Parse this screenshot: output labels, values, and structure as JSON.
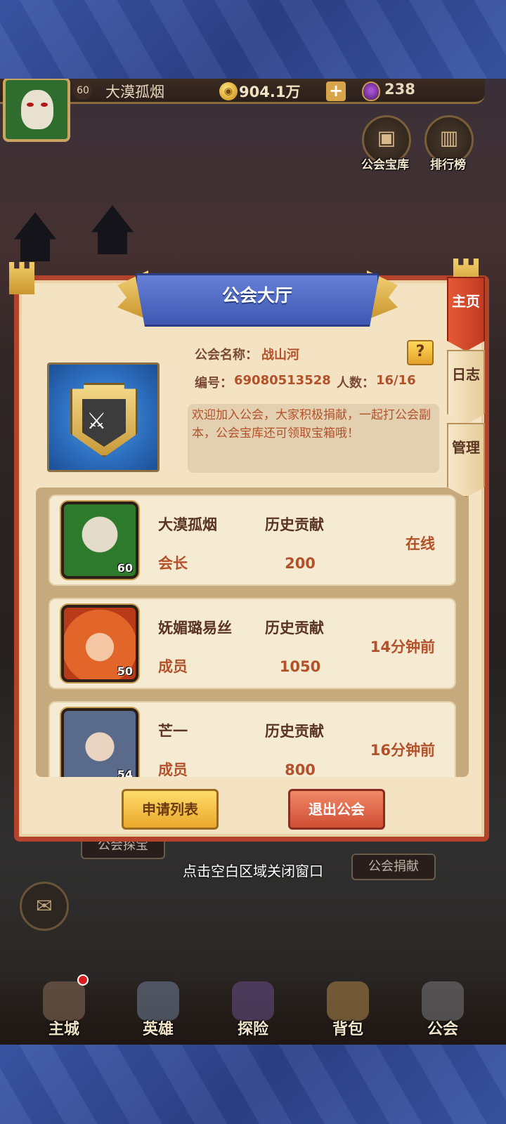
{
  "topbar": {
    "level": "60",
    "player_name": "大漠孤烟",
    "gold": "904.1万",
    "plus": "+",
    "gems": "238"
  },
  "top_buttons": [
    {
      "label": "公会宝库",
      "icon": "treasure-chest-icon"
    },
    {
      "label": "排行榜",
      "icon": "ranking-bars-icon"
    }
  ],
  "dialog": {
    "title": "公会大厅",
    "guild_name_label": "公会名称：",
    "guild_name": "战山河",
    "id_label": "编号：",
    "id_value": "69080513528",
    "count_label": "人数：",
    "count_value": "16/16",
    "help": "?",
    "notice": "欢迎加入公会，大家积极捐献，一起打公会副本，公会宝库还可领取宝箱哦！",
    "members": [
      {
        "name": "大漠孤烟",
        "role": "会长",
        "history_label": "历史贡献",
        "contribution": "200",
        "status": "在线",
        "level": "60"
      },
      {
        "name": "妩媚璐易丝",
        "role": "成员",
        "history_label": "历史贡献",
        "contribution": "1050",
        "status": "14分钟前",
        "level": "50"
      },
      {
        "name": "芒一",
        "role": "成员",
        "history_label": "历史贡献",
        "contribution": "800",
        "status": "16分钟前",
        "level": "54"
      }
    ],
    "apply_list_btn": "申请列表",
    "quit_btn": "退出公会"
  },
  "side_tabs": [
    {
      "label": "主页",
      "active": true
    },
    {
      "label": "日志",
      "active": false
    },
    {
      "label": "管理",
      "active": false
    }
  ],
  "background": {
    "guild_explore": "公会探宝",
    "guild_donate": "公会捐献",
    "close_hint": "点击空白区域关闭窗口"
  },
  "bottom_nav": [
    {
      "label": "主城",
      "icon": "castle-icon"
    },
    {
      "label": "英雄",
      "icon": "hero-icon"
    },
    {
      "label": "探险",
      "icon": "portal-icon"
    },
    {
      "label": "背包",
      "icon": "backpack-icon"
    },
    {
      "label": "公会",
      "icon": "guild-tower-icon"
    }
  ],
  "colors": {
    "dialog_border": "#b3432a",
    "dialog_bg": "#f3e3c3",
    "title_banner": "#4f69c4",
    "accent_text": "#b3512a",
    "active_tab": "#d24a2c"
  }
}
